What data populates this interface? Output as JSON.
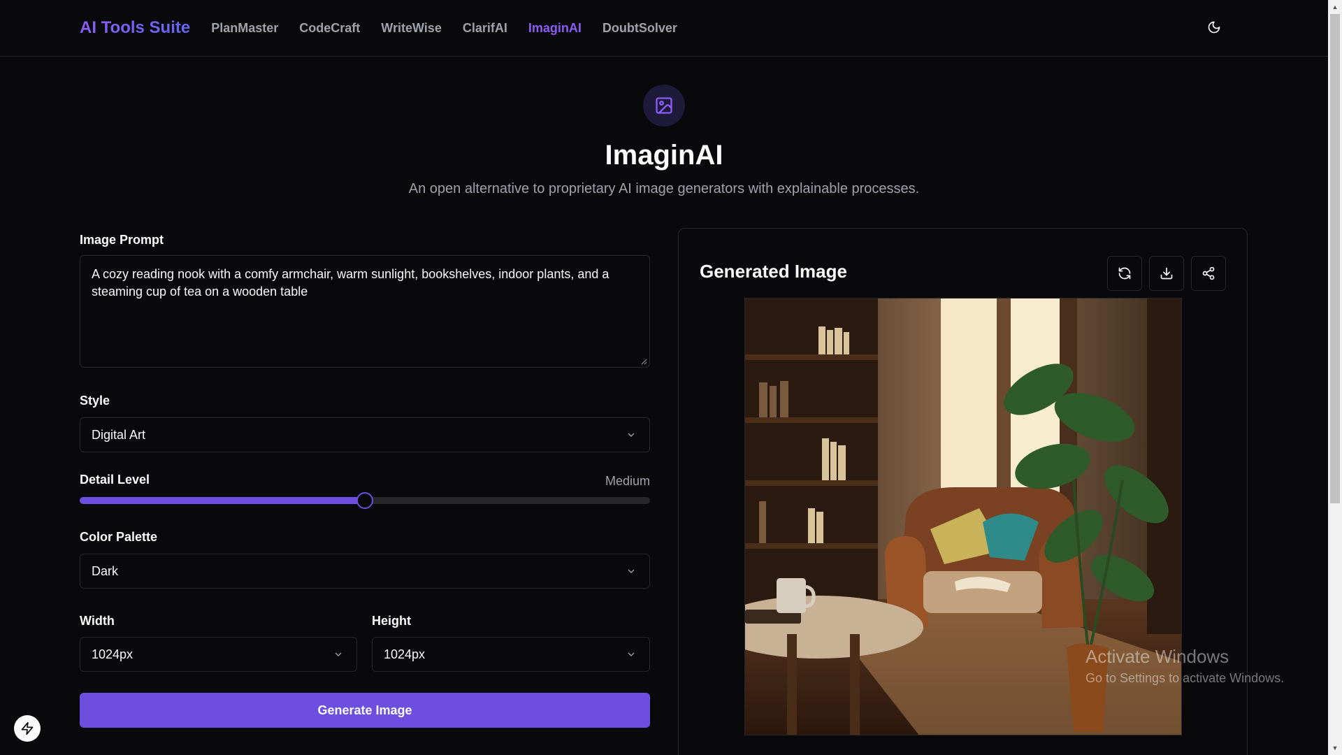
{
  "header": {
    "brand": "AI Tools Suite",
    "nav": [
      {
        "label": "PlanMaster",
        "active": false
      },
      {
        "label": "CodeCraft",
        "active": false
      },
      {
        "label": "WriteWise",
        "active": false
      },
      {
        "label": "ClarifAI",
        "active": false
      },
      {
        "label": "ImaginAI",
        "active": true
      },
      {
        "label": "DoubtSolver",
        "active": false
      }
    ],
    "theme_icon": "moon-icon"
  },
  "hero": {
    "icon": "image-icon",
    "title": "ImaginAI",
    "subtitle": "An open alternative to proprietary AI image generators with explainable processes."
  },
  "form": {
    "prompt_label": "Image Prompt",
    "prompt_value": "A cozy reading nook with a comfy armchair, warm sunlight, bookshelves, indoor plants, and a steaming cup of tea on a wooden table",
    "style_label": "Style",
    "style_value": "Digital Art",
    "detail_label": "Detail Level",
    "detail_value": "Medium",
    "detail_level_fraction": 0.5,
    "palette_label": "Color Palette",
    "palette_value": "Dark",
    "width_label": "Width",
    "width_value": "1024px",
    "height_label": "Height",
    "height_value": "1024px",
    "generate_label": "Generate Image"
  },
  "result": {
    "title": "Generated Image",
    "actions": [
      "refresh-icon",
      "download-icon",
      "share-icon"
    ]
  },
  "watermark": {
    "title": "Activate Windows",
    "subtitle": "Go to Settings to activate Windows."
  },
  "colors": {
    "background": "#09090b",
    "accent": "#6d4fe0",
    "active_nav": "#8b5cf6",
    "border": "#27272a",
    "muted_text": "#a1a1aa"
  }
}
